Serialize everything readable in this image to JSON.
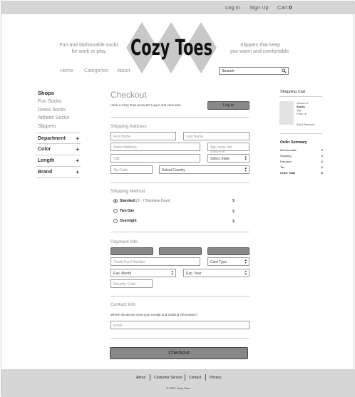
{
  "header": {
    "login": "Log In",
    "signup": "Sign Up",
    "cart_label": "Cart",
    "cart_count": "0"
  },
  "brand": {
    "name": "Cozy Toes",
    "tagline_left": [
      "Fun and fashionable socks",
      "for work or play."
    ],
    "tagline_right": [
      "Slippers that keep",
      "you warm and comfortable."
    ]
  },
  "nav": {
    "items": [
      "Home",
      "Categories",
      "About"
    ],
    "search_placeholder": "Search",
    "search_icon": "magnifier-icon"
  },
  "sidebar": {
    "title": "Shops",
    "links": [
      "Fun Socks",
      "Dress Socks",
      "Athletic Socks",
      "Slippers"
    ],
    "facets": [
      "Department",
      "Color",
      "Length",
      "Brand"
    ],
    "facet_icon": "+"
  },
  "checkout": {
    "title": "Checkout",
    "signin_prompt": "Have a Cozy Toes account? Log in and save time.",
    "login_button": "Log in",
    "shipping_address": {
      "title": "Shipping Address",
      "first_name": "First Name",
      "last_name": "Last Name",
      "street": "Street Address",
      "apt": "Apt, suite, etc. (optional)",
      "city": "City",
      "state": "Select State",
      "zip": "Zip Code",
      "country": "Select Country"
    },
    "shipping_method": {
      "title": "Shipping Method",
      "options": [
        {
          "label": "Standard",
          "note": "(3 - 7 Business Days)",
          "price": "$",
          "selected": true
        },
        {
          "label": "Two Day",
          "note": "",
          "price": "$",
          "selected": false
        },
        {
          "label": "Overnight",
          "note": "",
          "price": "$",
          "selected": false
        }
      ]
    },
    "payment": {
      "title": "Payment Info",
      "card_number": "Credit Card Number",
      "card_type": "Card Type",
      "exp_month": "Exp. Month",
      "exp_year": "Exp. Year",
      "security_code": "Security Code"
    },
    "contact": {
      "title": "Contact Info",
      "question": "Where should we send your receipt and tracking information?",
      "email": "Email"
    },
    "submit": "Checkout"
  },
  "cart": {
    "title": "Shopping Cart",
    "item": {
      "line1": "Women's",
      "name": "Socks",
      "qty": "Qty",
      "price": "Price: $"
    },
    "edit": "Edit",
    "remove": "Remove"
  },
  "order_summary": {
    "title": "Order Summary",
    "rows": [
      {
        "label": "Merchandise",
        "value": "$"
      },
      {
        "label": "Shipping",
        "value": "$"
      },
      {
        "label": "Discount",
        "value": "$"
      },
      {
        "label": "Tax",
        "value": "$"
      },
      {
        "label": "Order Total",
        "value": "$"
      }
    ]
  },
  "footer": {
    "links": [
      "About",
      "Costumer Service",
      "Contact",
      "Privacy"
    ],
    "copyright": "© 2017 Cozy Toes"
  },
  "colors": {
    "bar_gray": "#d6d6d6",
    "button_gray": "#888888",
    "diamond_gray": "#c8c8c8"
  }
}
